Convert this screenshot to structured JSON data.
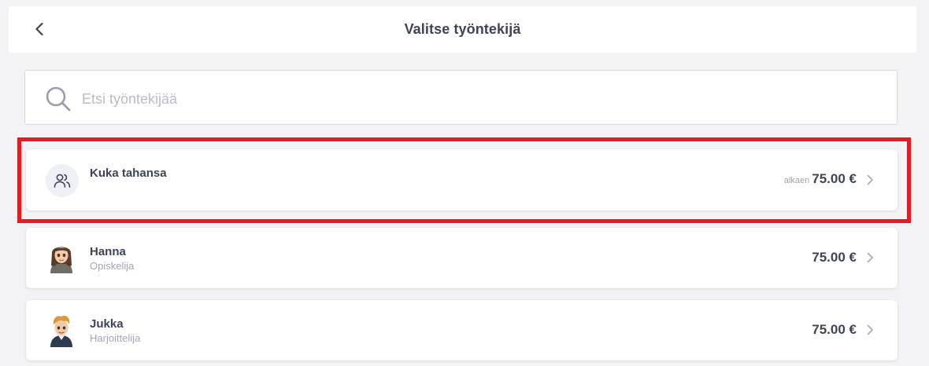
{
  "header": {
    "title": "Valitse työntekijä",
    "back_icon": "chevron-left-icon"
  },
  "search": {
    "placeholder": "Etsi työntekijää",
    "value": "",
    "icon": "search-icon"
  },
  "employees": [
    {
      "name": "Kuka tahansa",
      "role": "",
      "price_prefix": "alkaen",
      "price": "75.00 €",
      "icon": "users-icon",
      "selected": true
    },
    {
      "name": "Hanna",
      "role": "Opiskelija",
      "price_prefix": "",
      "price": "75.00 €",
      "icon": "avatar-hanna"
    },
    {
      "name": "Jukka",
      "role": "Harjoittelija",
      "price_prefix": "",
      "price": "75.00 €",
      "icon": "avatar-jukka"
    }
  ],
  "colors": {
    "highlight": "#e31b23",
    "background": "#f3f3f6",
    "text": "#3e4456",
    "muted": "#a3a7b5"
  }
}
